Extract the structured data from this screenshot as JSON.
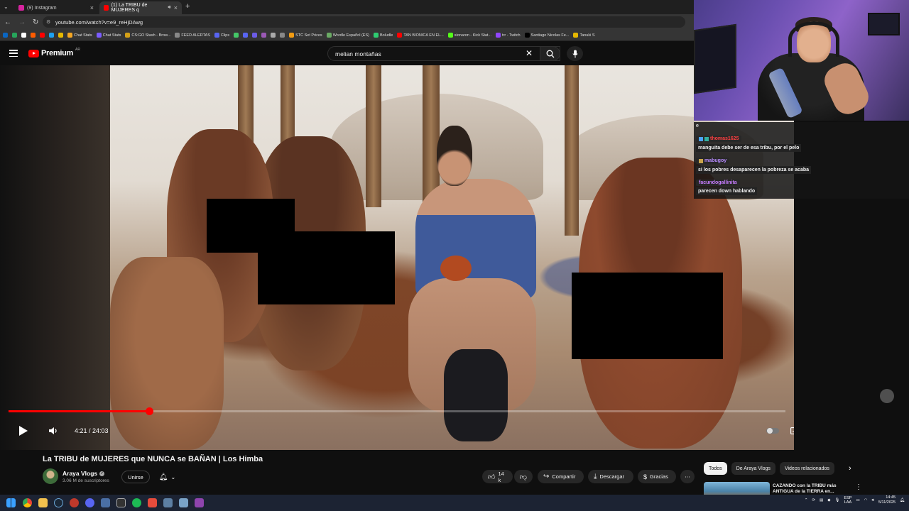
{
  "browser": {
    "tabs": [
      {
        "title": "(9) Instagram",
        "active": false,
        "favicon_color": "#d6249f"
      },
      {
        "title": "(1) La TRIBU de MUJERES q",
        "active": true,
        "favicon_color": "#ff0000"
      }
    ],
    "new_tab_symbol": "+",
    "url": "youtube.com/watch?v=e9_reHjDAwg",
    "bookmarks": [
      {
        "label": "",
        "color": "#0a66c2"
      },
      {
        "label": "",
        "color": "#26a65b"
      },
      {
        "label": "",
        "color": "#ffffff"
      },
      {
        "label": "",
        "color": "#ff5c00"
      },
      {
        "label": "",
        "color": "#ff0000"
      },
      {
        "label": "",
        "color": "#1da1f2"
      },
      {
        "label": "",
        "color": "#e6b800"
      },
      {
        "label": "Chat Stats",
        "color": "#f5a623"
      },
      {
        "label": "Chat Stats",
        "color": "#7b5cff"
      },
      {
        "label": "CS:GO Stash - Brow...",
        "color": "#d4a017"
      },
      {
        "label": "FEED ALERTAS",
        "color": "#888888"
      },
      {
        "label": "Clips",
        "color": "#5865f2"
      },
      {
        "label": "",
        "color": "#44c767"
      },
      {
        "label": "",
        "color": "#5865f2"
      },
      {
        "label": "",
        "color": "#6c5ce7"
      },
      {
        "label": "",
        "color": "#9b59b6"
      },
      {
        "label": "",
        "color": "#aaaaaa"
      },
      {
        "label": "",
        "color": "#888888"
      },
      {
        "label": "STC Set Prices",
        "color": "#f39c12"
      },
      {
        "label": "Wordle Español (ES)",
        "color": "#6aaa64"
      },
      {
        "label": "Boludle",
        "color": "#2ecc71"
      },
      {
        "label": "TAN BIONICA EN EL...",
        "color": "#ff0000"
      },
      {
        "label": "sionaron - Kick Stat...",
        "color": "#53fc18"
      },
      {
        "label": "trr - Twitch",
        "color": "#9146ff"
      },
      {
        "label": "Santiago Nicolas Fe...",
        "color": "#000000"
      },
      {
        "label": "Tanuki S",
        "color": "#e6b800"
      }
    ]
  },
  "youtube": {
    "logo_text": "Premium",
    "region": "AR",
    "search_query": "melian montañas",
    "video": {
      "current_time": "4:21",
      "duration": "24:03",
      "time_display": "4:21 / 24:03",
      "progress": 0.181,
      "hd_badge": "HD"
    },
    "title": "La TRIBU de MUJERES que NUNCA se BAÑAN | Los Himba",
    "channel": {
      "name": "Araya Vlogs",
      "verified": true,
      "subscribers": "3.06 M de suscriptores"
    },
    "join_label": "Unirse",
    "actions": {
      "likes": "14 k",
      "share": "Compartir",
      "download": "Descargar",
      "thanks": "Gracias",
      "more": "⋯"
    },
    "chips": [
      "Todos",
      "De Araya Vlogs",
      "Videos relacionados"
    ],
    "recommendation": {
      "title": "CAZANDO con la TRIBU más ANTIGUA de la TIERRA en..."
    }
  },
  "chat": {
    "first_line": "e",
    "messages": [
      {
        "user": "thomas1625",
        "user_color": "#ff4040",
        "text": "manguita debe ser de esa tribu, por el pelo"
      },
      {
        "user": "mabugoy",
        "user_color": "#b98cff",
        "text": "si los pobres desaparecen la pobreza se acaba"
      },
      {
        "user": "facundogallinita",
        "user_color": "#c77dff",
        "text": "parecen down hablando"
      }
    ]
  },
  "taskbar": {
    "language": "ESP",
    "language_sub": "LAA",
    "time": "14:45",
    "date": "5/11/2025"
  },
  "colors": {
    "accent": "#ff0000",
    "background": "#0f0f0f",
    "pill": "#272727"
  }
}
